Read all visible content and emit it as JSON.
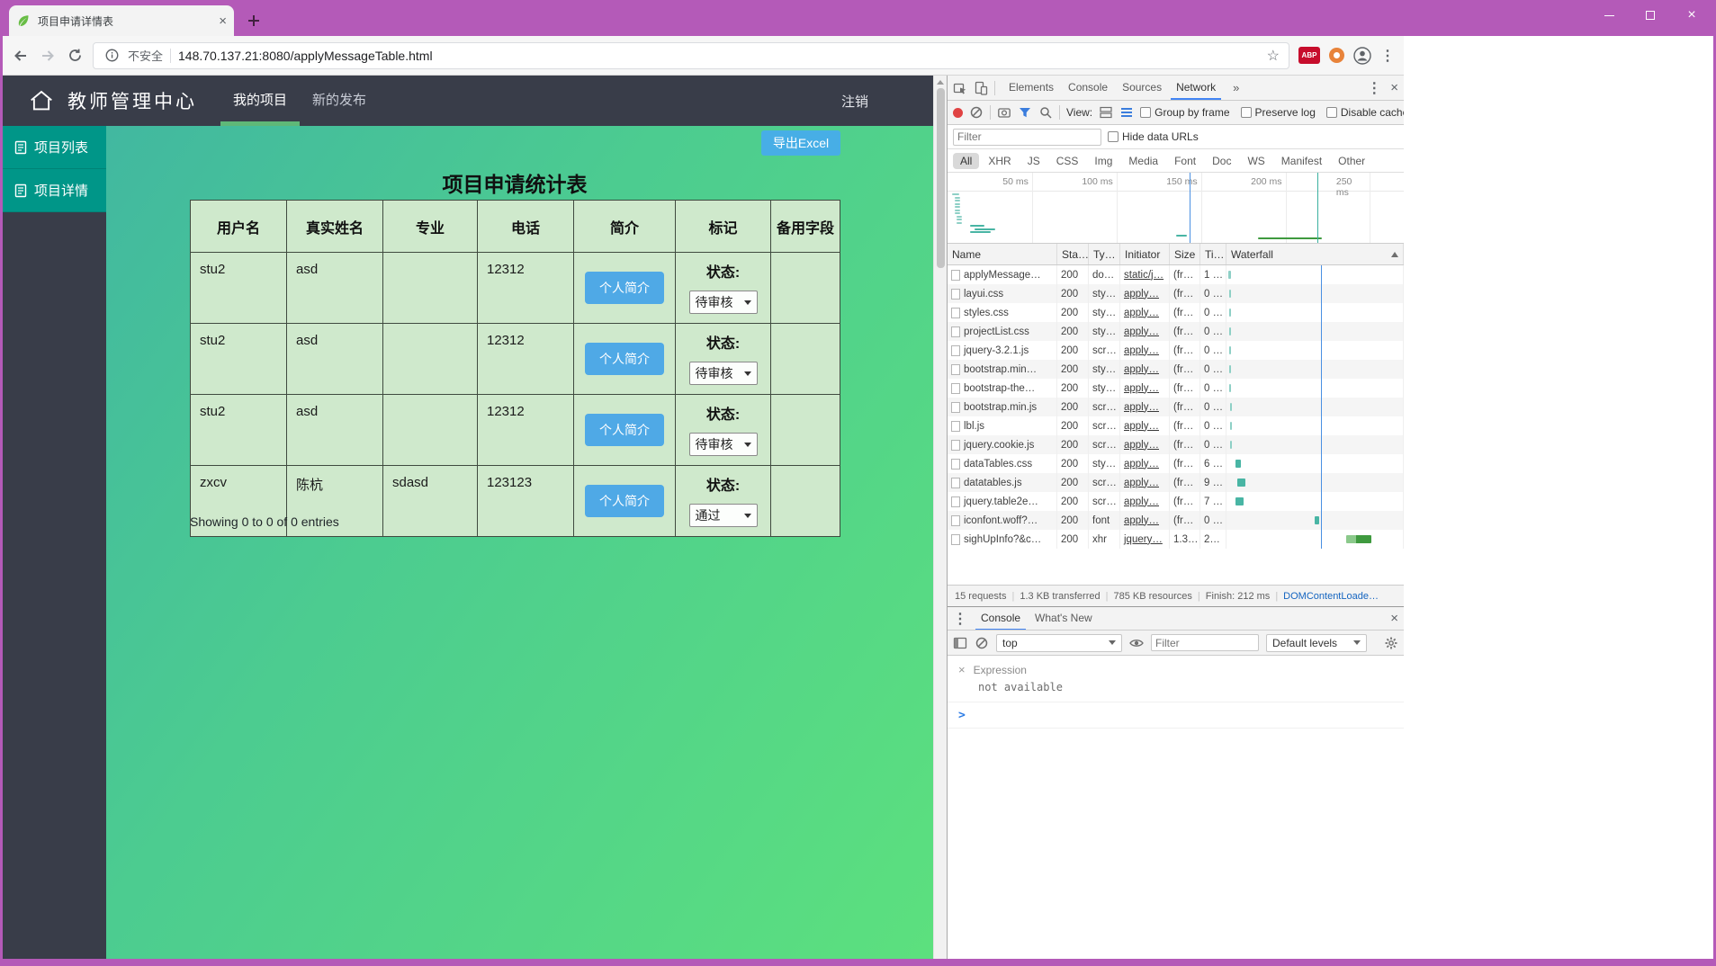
{
  "window": {
    "tab_title": "项目申请详情表"
  },
  "browser": {
    "security_text": "不安全",
    "url": "148.70.137.21:8080/applyMessageTable.html",
    "adblock_label": "ABP"
  },
  "page": {
    "navbar": {
      "brand": "教师管理中心",
      "items": [
        {
          "label": "我的项目",
          "active": true
        },
        {
          "label": "新的发布",
          "active": false
        }
      ],
      "logout": "注销"
    },
    "sidebar": {
      "items": [
        "项目列表",
        "项目详情"
      ]
    },
    "export_button": "导出Excel",
    "title": "项目申请统计表",
    "table": {
      "headers": [
        "用户名",
        "真实姓名",
        "专业",
        "电话",
        "简介",
        "标记",
        "备用字段"
      ],
      "rows": [
        {
          "username": "stu2",
          "real_name": "asd",
          "major": "",
          "phone": "12312",
          "intro_button": "个人简介",
          "status_label": "状态:",
          "status_value": "待审核"
        },
        {
          "username": "stu2",
          "real_name": "asd",
          "major": "",
          "phone": "12312",
          "intro_button": "个人简介",
          "status_label": "状态:",
          "status_value": "待审核"
        },
        {
          "username": "stu2",
          "real_name": "asd",
          "major": "",
          "phone": "12312",
          "intro_button": "个人简介",
          "status_label": "状态:",
          "status_value": "待审核"
        },
        {
          "username": "zxcv",
          "real_name": "陈杭",
          "major": "sdasd",
          "phone": "123123",
          "intro_button": "个人简介",
          "status_label": "状态:",
          "status_value": "通过"
        }
      ]
    },
    "entries_info": "Showing 0 to 0 of 0 entries"
  },
  "devtools": {
    "tabs": [
      {
        "label": "Elements",
        "active": false
      },
      {
        "label": "Console",
        "active": false
      },
      {
        "label": "Sources",
        "active": false
      },
      {
        "label": "Network",
        "active": true
      }
    ],
    "tabs_overflow": "»",
    "network": {
      "view_label": "View:",
      "toolbar_checkboxes": [
        "Group by frame",
        "Preserve log",
        "Disable cache"
      ],
      "filter_placeholder": "Filter",
      "hide_data_urls_label": "Hide data URLs",
      "pills": [
        {
          "label": "All",
          "active": true
        },
        {
          "label": "XHR"
        },
        {
          "label": "JS"
        },
        {
          "label": "CSS"
        },
        {
          "label": "Img"
        },
        {
          "label": "Media"
        },
        {
          "label": "Font"
        },
        {
          "label": "Doc"
        },
        {
          "label": "WS"
        },
        {
          "label": "Manifest"
        },
        {
          "label": "Other"
        }
      ],
      "ruler_ticks": [
        "50 ms",
        "100 ms",
        "150 ms",
        "200 ms",
        "250 ms"
      ],
      "columns": [
        "Name",
        "Sta…",
        "Ty…",
        "Initiator",
        "Size",
        "Ti…",
        "Waterfall"
      ],
      "requests": [
        {
          "name": "applyMessage…",
          "status": "200",
          "type": "do…",
          "initiator": "static/j…",
          "size": "(fr…",
          "time": "1 …",
          "wf": {
            "o": 1,
            "w": 1.5,
            "c": "#8ed0c6"
          }
        },
        {
          "name": "layui.css",
          "status": "200",
          "type": "sty…",
          "initiator": "apply…",
          "size": "(fr…",
          "time": "0 …",
          "wf": {
            "o": 1.5,
            "w": 1.2,
            "c": "#8ed0c6"
          }
        },
        {
          "name": "styles.css",
          "status": "200",
          "type": "sty…",
          "initiator": "apply…",
          "size": "(fr…",
          "time": "0 …",
          "wf": {
            "o": 1.5,
            "w": 1.2,
            "c": "#8ed0c6"
          }
        },
        {
          "name": "projectList.css",
          "status": "200",
          "type": "sty…",
          "initiator": "apply…",
          "size": "(fr…",
          "time": "0 …",
          "wf": {
            "o": 1.5,
            "w": 1.2,
            "c": "#8ed0c6"
          }
        },
        {
          "name": "jquery-3.2.1.js",
          "status": "200",
          "type": "scr…",
          "initiator": "apply…",
          "size": "(fr…",
          "time": "0 …",
          "wf": {
            "o": 1.5,
            "w": 1.2,
            "c": "#8ed0c6"
          }
        },
        {
          "name": "bootstrap.min…",
          "status": "200",
          "type": "sty…",
          "initiator": "apply…",
          "size": "(fr…",
          "time": "0 …",
          "wf": {
            "o": 1.5,
            "w": 1.2,
            "c": "#8ed0c6"
          }
        },
        {
          "name": "bootstrap-the…",
          "status": "200",
          "type": "sty…",
          "initiator": "apply…",
          "size": "(fr…",
          "time": "0 …",
          "wf": {
            "o": 1.5,
            "w": 1.2,
            "c": "#8ed0c6"
          }
        },
        {
          "name": "bootstrap.min.js",
          "status": "200",
          "type": "scr…",
          "initiator": "apply…",
          "size": "(fr…",
          "time": "0 …",
          "wf": {
            "o": 2,
            "w": 1.2,
            "c": "#8ed0c6"
          }
        },
        {
          "name": "lbl.js",
          "status": "200",
          "type": "scr…",
          "initiator": "apply…",
          "size": "(fr…",
          "time": "0 …",
          "wf": {
            "o": 2,
            "w": 1.2,
            "c": "#8ed0c6"
          }
        },
        {
          "name": "jquery.cookie.js",
          "status": "200",
          "type": "scr…",
          "initiator": "apply…",
          "size": "(fr…",
          "time": "0 …",
          "wf": {
            "o": 2,
            "w": 1.2,
            "c": "#8ed0c6"
          }
        },
        {
          "name": "dataTables.css",
          "status": "200",
          "type": "sty…",
          "initiator": "apply…",
          "size": "(fr…",
          "time": "6 …",
          "wf": {
            "o": 5,
            "w": 3,
            "c": "#49b5a4"
          }
        },
        {
          "name": "datatables.js",
          "status": "200",
          "type": "scr…",
          "initiator": "apply…",
          "size": "(fr…",
          "time": "9 …",
          "wf": {
            "o": 6,
            "w": 4.5,
            "c": "#49b5a4"
          }
        },
        {
          "name": "jquery.table2e…",
          "status": "200",
          "type": "scr…",
          "initiator": "apply…",
          "size": "(fr…",
          "time": "7 …",
          "wf": {
            "o": 5,
            "w": 4.5,
            "c": "#49b5a4"
          }
        },
        {
          "name": "iconfont.woff?…",
          "status": "200",
          "type": "font",
          "initiator": "apply…",
          "size": "(fr…",
          "time": "0 …",
          "wf": {
            "o": 50,
            "w": 2.5,
            "c": "#49b5a4"
          }
        },
        {
          "name": "sighUpInfo?&c…",
          "status": "200",
          "type": "xhr",
          "initiator": "jquery…",
          "size": "1.3…",
          "time": "2…",
          "wf": {
            "o": 68,
            "w": 14,
            "c": "#8bc98b",
            "c2": "#3f9a3f"
          }
        }
      ],
      "summary": [
        {
          "text": "15 requests"
        },
        {
          "text": "1.3 KB transferred"
        },
        {
          "text": "785 KB resources"
        },
        {
          "text": "Finish: 212 ms"
        },
        {
          "text": "DOMContentLoade…",
          "highlight": "#1565c0"
        }
      ]
    },
    "console": {
      "tabs": [
        {
          "label": "Console",
          "active": true
        },
        {
          "label": "What's New",
          "active": false
        }
      ],
      "context_selector": "top",
      "filter_placeholder": "Filter",
      "levels_label": "Default levels",
      "expression_label": "Expression",
      "expression_value": "not available",
      "prompt_char": ">"
    }
  },
  "colors": {
    "titlebar_magenta": "#b45ab8",
    "navbar_dark": "#393d49",
    "accent_green": "#5FB878",
    "sidebar_teal": "#009688",
    "button_blue": "#47aee6",
    "waterfall_teal": "#49b5a4",
    "waterfall_green": "#3f9a3f",
    "summary_link_blue": "#1565c0"
  }
}
